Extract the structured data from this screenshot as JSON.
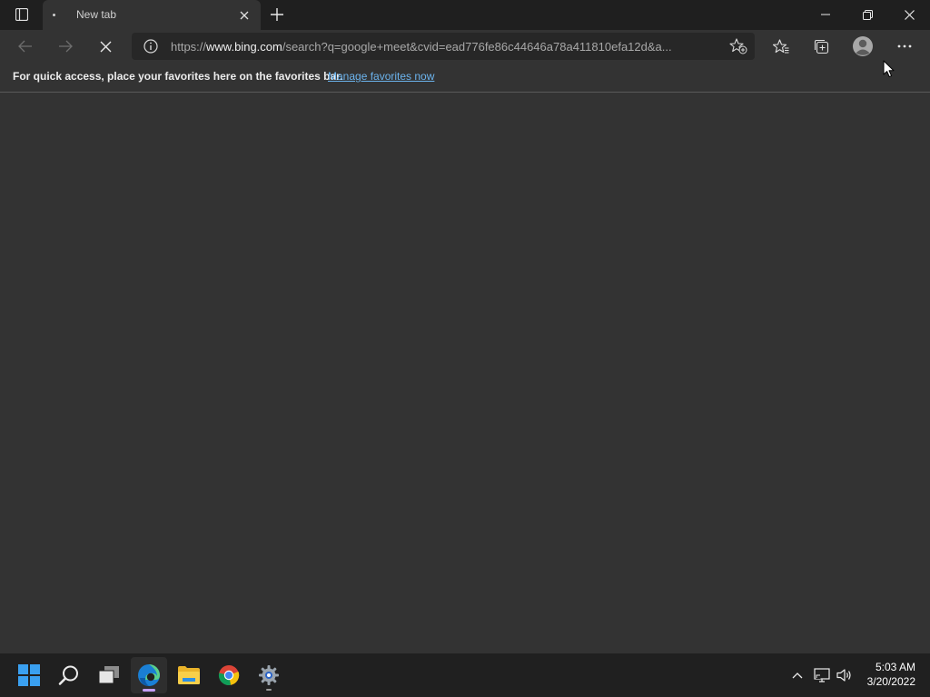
{
  "tab": {
    "title": "New tab"
  },
  "addressbar": {
    "url_scheme": "https://",
    "url_host": "www.bing.com",
    "url_rest": "/search?q=google+meet&cvid=ead776fe86c44646a78a411810efa12d&a..."
  },
  "favorites_bar": {
    "message": "For quick access, place your favorites here on the favorites bar.",
    "link_label": "Manage favorites now"
  },
  "taskbar": {
    "apps": [
      "start",
      "search",
      "task-view",
      "edge",
      "file-explorer",
      "chrome",
      "settings"
    ],
    "time": "5:03 AM",
    "date": "3/20/2022"
  },
  "colors": {
    "window_bg": "#333333",
    "titlebar_bg": "#1f1f1f",
    "link": "#6cb4ee",
    "taskbar_bg": "#202020",
    "edge_indicator": "#c6a0ff"
  }
}
